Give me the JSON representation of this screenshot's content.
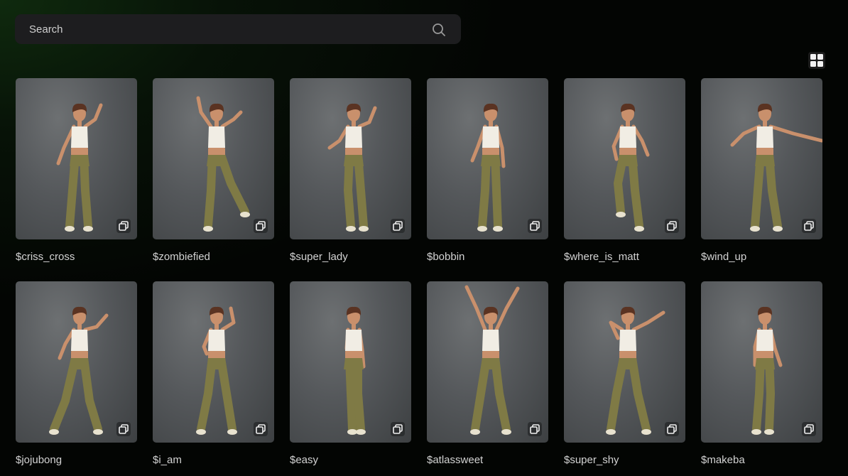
{
  "search": {
    "placeholder": "Search"
  },
  "icons": {
    "search": "search-icon",
    "view_toggle": "grid-view-icon",
    "copy": "copy-icon"
  },
  "cards": [
    {
      "label": "$criss_cross"
    },
    {
      "label": "$zombiefied"
    },
    {
      "label": "$super_lady"
    },
    {
      "label": "$bobbin"
    },
    {
      "label": "$where_is_matt"
    },
    {
      "label": "$wind_up"
    },
    {
      "label": "$jojubong"
    },
    {
      "label": "$i_am"
    },
    {
      "label": "$easy"
    },
    {
      "label": "$atlassweet"
    },
    {
      "label": "$super_shy"
    },
    {
      "label": "$makeba"
    }
  ]
}
